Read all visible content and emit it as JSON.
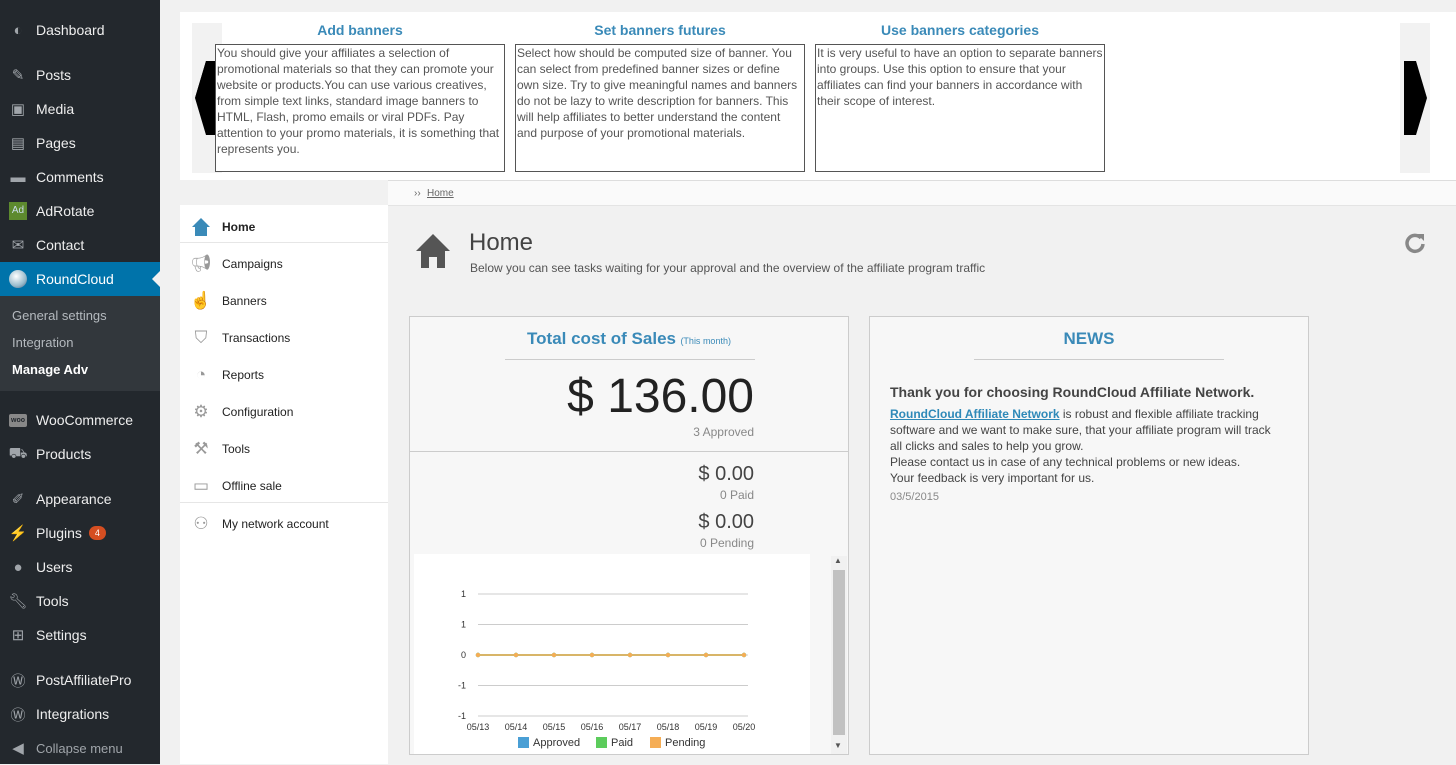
{
  "wp_menu": {
    "items": [
      {
        "label": "Dashboard",
        "icon": "dashboard-icon"
      },
      {
        "label": "Posts",
        "icon": "pin-icon"
      },
      {
        "label": "Media",
        "icon": "media-icon"
      },
      {
        "label": "Pages",
        "icon": "pages-icon"
      },
      {
        "label": "Comments",
        "icon": "comment-icon"
      },
      {
        "label": "AdRotate",
        "icon": "adrotate-icon"
      },
      {
        "label": "Contact",
        "icon": "envelope-icon"
      },
      {
        "label": "RoundCloud",
        "icon": "roundcloud-icon"
      },
      {
        "label": "WooCommerce",
        "icon": "woocommerce-icon"
      },
      {
        "label": "Products",
        "icon": "cart-icon"
      },
      {
        "label": "Appearance",
        "icon": "brush-icon"
      },
      {
        "label": "Plugins",
        "icon": "plugin-icon",
        "badge": "4"
      },
      {
        "label": "Users",
        "icon": "user-icon"
      },
      {
        "label": "Tools",
        "icon": "wrench-icon"
      },
      {
        "label": "Settings",
        "icon": "settings-icon"
      },
      {
        "label": "PostAffiliatePro",
        "icon": "wordpress-icon"
      },
      {
        "label": "Integrations",
        "icon": "wordpress-icon"
      }
    ],
    "submenu": [
      "General settings",
      "Integration",
      "Manage Adv"
    ],
    "collapse": "Collapse menu",
    "active_color": "#0073aa"
  },
  "features": [
    {
      "title": "Add banners",
      "text": "You should give your affiliates a selection of promotional materials so that they can promote your website or products.You can use various creatives, from simple text links, standard image banners to HTML, Flash, promo emails or viral PDFs. Pay attention to your promo materials, it is something that represents you."
    },
    {
      "title": "Set banners futures",
      "text": "Select how should be computed size of banner. You can select from predefined banner sizes or define own size. Try to give meaningful names and banners do not be lazy to write description for banners. This will help affiliates to better understand the content and purpose of your promotional materials."
    },
    {
      "title": "Use banners categories",
      "text": "It is very useful to have an option to separate banners into groups. Use this option to ensure that your affiliates can find your banners in accordance with their scope of interest."
    }
  ],
  "breadcrumb": {
    "sep": "››",
    "home": "Home"
  },
  "left_nav": [
    {
      "label": "Home",
      "icon": "home-icon"
    },
    {
      "label": "Campaigns",
      "icon": "megaphone-icon"
    },
    {
      "label": "Banners",
      "icon": "hand-pointer-icon"
    },
    {
      "label": "Transactions",
      "icon": "basket-icon"
    },
    {
      "label": "Reports",
      "icon": "pie-chart-icon"
    },
    {
      "label": "Configuration",
      "icon": "gear-icon"
    },
    {
      "label": "Tools",
      "icon": "tools-icon"
    },
    {
      "label": "Offline sale",
      "icon": "offline-sale-icon"
    },
    {
      "label": "My network account",
      "icon": "network-users-icon"
    }
  ],
  "page": {
    "title": "Home",
    "subtitle": "Below you can see tasks waiting for your approval and the overview of the affiliate program traffic"
  },
  "sales": {
    "title": "Total cost of Sales",
    "period": "(This month)",
    "total": "$ 136.00",
    "approved_label": "3 Approved",
    "paid_value": "$ 0.00",
    "paid_label": "0 Paid",
    "pending_value": "$ 0.00",
    "pending_label": "0 Pending"
  },
  "chart_data": {
    "type": "line",
    "categories": [
      "05/13",
      "05/14",
      "05/15",
      "05/16",
      "05/17",
      "05/18",
      "05/19",
      "05/20"
    ],
    "y_ticks": [
      "1",
      "1",
      "0",
      "-1",
      "-1"
    ],
    "ylim": [
      -1,
      1
    ],
    "series": [
      {
        "name": "Approved",
        "color": "#4a9fd5",
        "values": [
          0,
          0,
          0,
          0,
          0,
          0,
          0,
          0
        ]
      },
      {
        "name": "Paid",
        "color": "#5ccc5c",
        "values": [
          0,
          0,
          0,
          0,
          0,
          0,
          0,
          0
        ]
      },
      {
        "name": "Pending",
        "color": "#f5ad55",
        "values": [
          0,
          0,
          0,
          0,
          0,
          0,
          0,
          0
        ]
      }
    ],
    "legend": "bottom",
    "grid": true
  },
  "news": {
    "title": "NEWS",
    "heading": "Thank you for choosing RoundCloud Affiliate Network.",
    "link_text": "RoundCloud Affiliate Network",
    "text1": " is robust and flexible affiliate tracking software and we want to make sure, that your affiliate program will track all clicks and sales to help you grow.",
    "text2": "Please contact us in case of any technical problems or new ideas.",
    "text3": "Your feedback is very important for us.",
    "date": "03/5/2015"
  }
}
